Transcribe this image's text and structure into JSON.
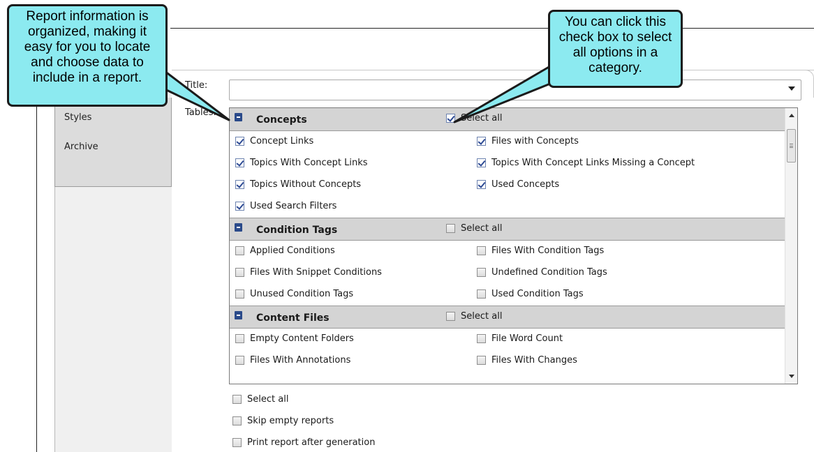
{
  "tabs": {
    "styles_label": "Styles",
    "archive_label": "Archive"
  },
  "form": {
    "title_label": "Title:",
    "title_value": "",
    "tables_label": "Tables:"
  },
  "categories": [
    {
      "name": "Concepts",
      "select_all_label": "Select all",
      "select_all_checked": true,
      "items": [
        {
          "label": "Concept Links",
          "checked": true
        },
        {
          "label": "Files with Concepts",
          "checked": true
        },
        {
          "label": "Topics With Concept Links",
          "checked": true
        },
        {
          "label": "Topics With Concept Links Missing a Concept",
          "checked": true
        },
        {
          "label": "Topics Without Concepts",
          "checked": true
        },
        {
          "label": "Used Concepts",
          "checked": true
        },
        {
          "label": "Used Search Filters",
          "checked": true
        }
      ]
    },
    {
      "name": "Condition Tags",
      "select_all_label": "Select all",
      "select_all_checked": false,
      "items": [
        {
          "label": "Applied Conditions",
          "checked": false
        },
        {
          "label": "Files With Condition Tags",
          "checked": false
        },
        {
          "label": "Files With Snippet Conditions",
          "checked": false
        },
        {
          "label": "Undefined Condition Tags",
          "checked": false
        },
        {
          "label": "Unused Condition Tags",
          "checked": false
        },
        {
          "label": "Used Condition Tags",
          "checked": false
        }
      ]
    },
    {
      "name": "Content Files",
      "select_all_label": "Select all",
      "select_all_checked": false,
      "items": [
        {
          "label": "Empty Content Folders",
          "checked": false
        },
        {
          "label": "File Word Count",
          "checked": false
        },
        {
          "label": "Files With Annotations",
          "checked": false
        },
        {
          "label": "Files With Changes",
          "checked": false
        }
      ]
    }
  ],
  "options": [
    {
      "label": "Select all",
      "checked": false
    },
    {
      "label": "Skip empty reports",
      "checked": false
    },
    {
      "label": "Print report after generation",
      "checked": false
    }
  ],
  "callouts": {
    "left": "Report information is organized, making it easy for you to locate and choose data to include in a report.",
    "right": "You can click this check box to select all options in a category."
  },
  "colors": {
    "callout_fill": "#8ceaf0",
    "category_header": "#d4d4d4",
    "checkmark": "#2d4a94"
  }
}
